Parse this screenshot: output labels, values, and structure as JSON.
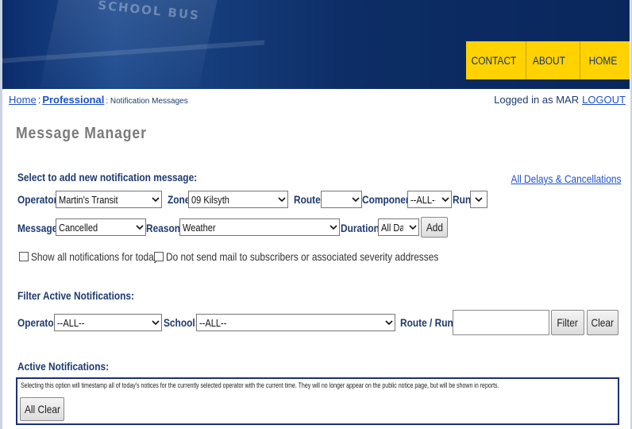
{
  "header": {
    "banner_text": "SCHOOL BUS",
    "nav": [
      "CONTACT",
      "ABOUT",
      "HOME"
    ]
  },
  "breadcrumb": {
    "home": "Home",
    "separator": ":",
    "professional": "Professional",
    "current": ": Notification Messages"
  },
  "login": {
    "text": "Logged in as MAR",
    "logout": "LOGOUT"
  },
  "page_title": "Message Manager",
  "add_section": {
    "label": "Select to add new notification message:",
    "all_delays_link": "All Delays & Cancellations",
    "operator_label": "Operator:",
    "operator_value": "Martin's Transit",
    "zone_label": "Zone:",
    "zone_value": "09 Kilsyth",
    "route_label": "Route:",
    "route_value": "",
    "component_label": "Component",
    "component_value": "--ALL--",
    "run_label": "Run",
    "run_value": "",
    "message_label": "Message:",
    "message_value": "Cancelled",
    "reason_label": "Reason:",
    "reason_value": "Weather",
    "duration_label": "Duration:",
    "duration_value": "All Day",
    "add_button": "Add",
    "show_all_label": "Show all notifications for today",
    "no_mail_label": "Do not send mail to subscribers or associated severity addresses"
  },
  "filter_section": {
    "label": "Filter Active Notifications:",
    "operator_label": "Operator:",
    "operator_value": "--ALL--",
    "school_label": "School:",
    "school_value": "--ALL--",
    "route_run_label": "Route / Run:",
    "route_run_value": "",
    "filter_button": "Filter",
    "clear_button": "Clear"
  },
  "active_section": {
    "label": "Active Notifications:",
    "note": "Selecting this option will timestamp all of today's notices for the currently selected operator with the current time. They will no longer appear on the public notice page, but will be shown in reports.",
    "all_clear_button": "All Clear"
  },
  "colors": {
    "banner_dark": "#0a275c",
    "nav_yellow": "#ffd200",
    "label_blue": "#1e3a6e",
    "link_blue": "#1f52c9",
    "box_border": "#1d2f7a"
  }
}
